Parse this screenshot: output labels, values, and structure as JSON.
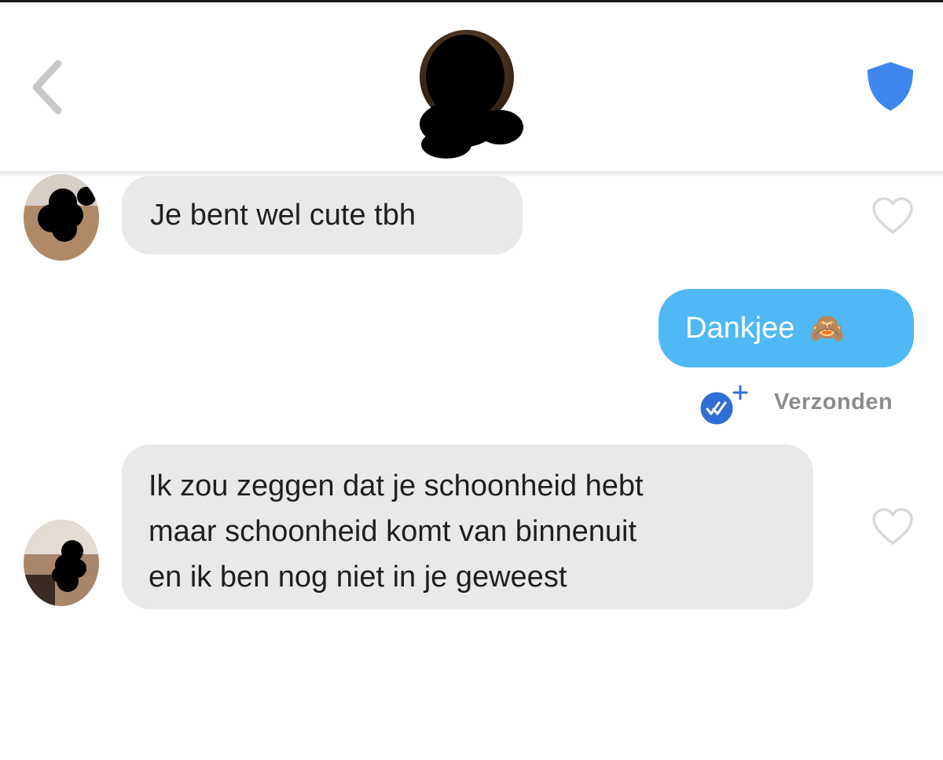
{
  "header": {
    "back_icon": "chevron-left-icon",
    "safety_icon": "shield-icon",
    "avatar_state": "obscured"
  },
  "messages": [
    {
      "direction": "incoming",
      "text": "Je bent wel cute tbh"
    },
    {
      "direction": "outgoing",
      "text": "Dankjee",
      "emoji": "🙈"
    },
    {
      "direction": "incoming",
      "lines": [
        "Ik zou zeggen dat je schoonheid hebt",
        "maar schoonheid komt van binnenuit",
        "en ik ben nog niet in je geweest"
      ]
    }
  ],
  "status": {
    "sent_label": "Verzonden",
    "badge_icon": "double-check-icon"
  },
  "colors": {
    "outgoing_bubble": "#50b9f5",
    "incoming_bubble": "#e9e9eb",
    "shield": "#3f86ef",
    "read_badge": "#2f6fd6"
  }
}
